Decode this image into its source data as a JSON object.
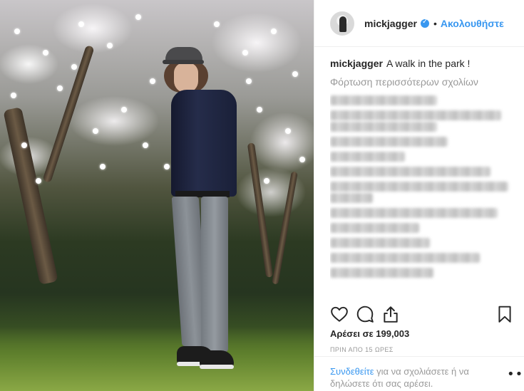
{
  "post": {
    "image_alt_subject": "man standing in a park in front of a flowering magnolia tree"
  },
  "header": {
    "username": "mickjagger",
    "separator": "•",
    "follow_label": "Ακολουθήστε"
  },
  "caption": {
    "username": "mickjagger",
    "text": "A walk in the park !"
  },
  "load_more_label": "Φόρτωση περισσότερων σχολίων",
  "actions": {
    "like_icon": "heart-icon",
    "comment_icon": "comment-icon",
    "share_icon": "share-icon",
    "save_icon": "bookmark-icon"
  },
  "likes_text": "Αρέσει σε 199,003",
  "time_text": "ΠΡΙΝ ΑΠΟ 15 ΩΡΕΣ",
  "footer": {
    "login_link": "Συνδεθείτε",
    "login_rest": " για να σχολιάσετε ή να δηλώσετε ότι σας αρέσει.",
    "more_icon": "ellipsis-icon",
    "more_label": "•••"
  },
  "colors": {
    "accent": "#3897f0",
    "muted": "#999999",
    "text": "#262626",
    "border": "#efefef"
  }
}
